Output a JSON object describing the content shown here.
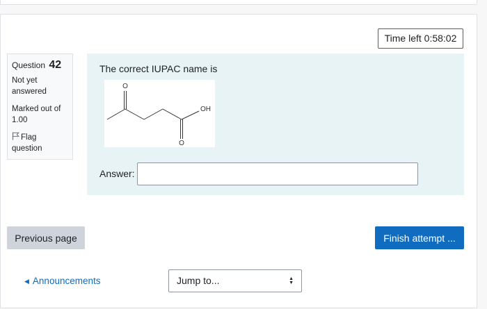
{
  "timer": {
    "label": "Time left",
    "value": "0:58:02"
  },
  "question_info": {
    "question_label": "Question",
    "question_number": "42",
    "state": "Not yet answered",
    "grade": "Marked out of 1.00",
    "flag_label": "Flag question"
  },
  "question": {
    "text": "The correct IUPAC name is",
    "structure_labels": {
      "ketone_o": "O",
      "acid_o": "O",
      "hydroxyl": "OH"
    },
    "answer_label": "Answer:",
    "answer_value": ""
  },
  "navigation": {
    "previous_page": "Previous page",
    "finish_attempt": "Finish attempt ...",
    "previous_activity": "Announcements",
    "jump_to": "Jump to..."
  },
  "colors": {
    "accent": "#0f6cbf",
    "timer_border": "#ca3120",
    "content_bg": "#e7f3f5"
  }
}
